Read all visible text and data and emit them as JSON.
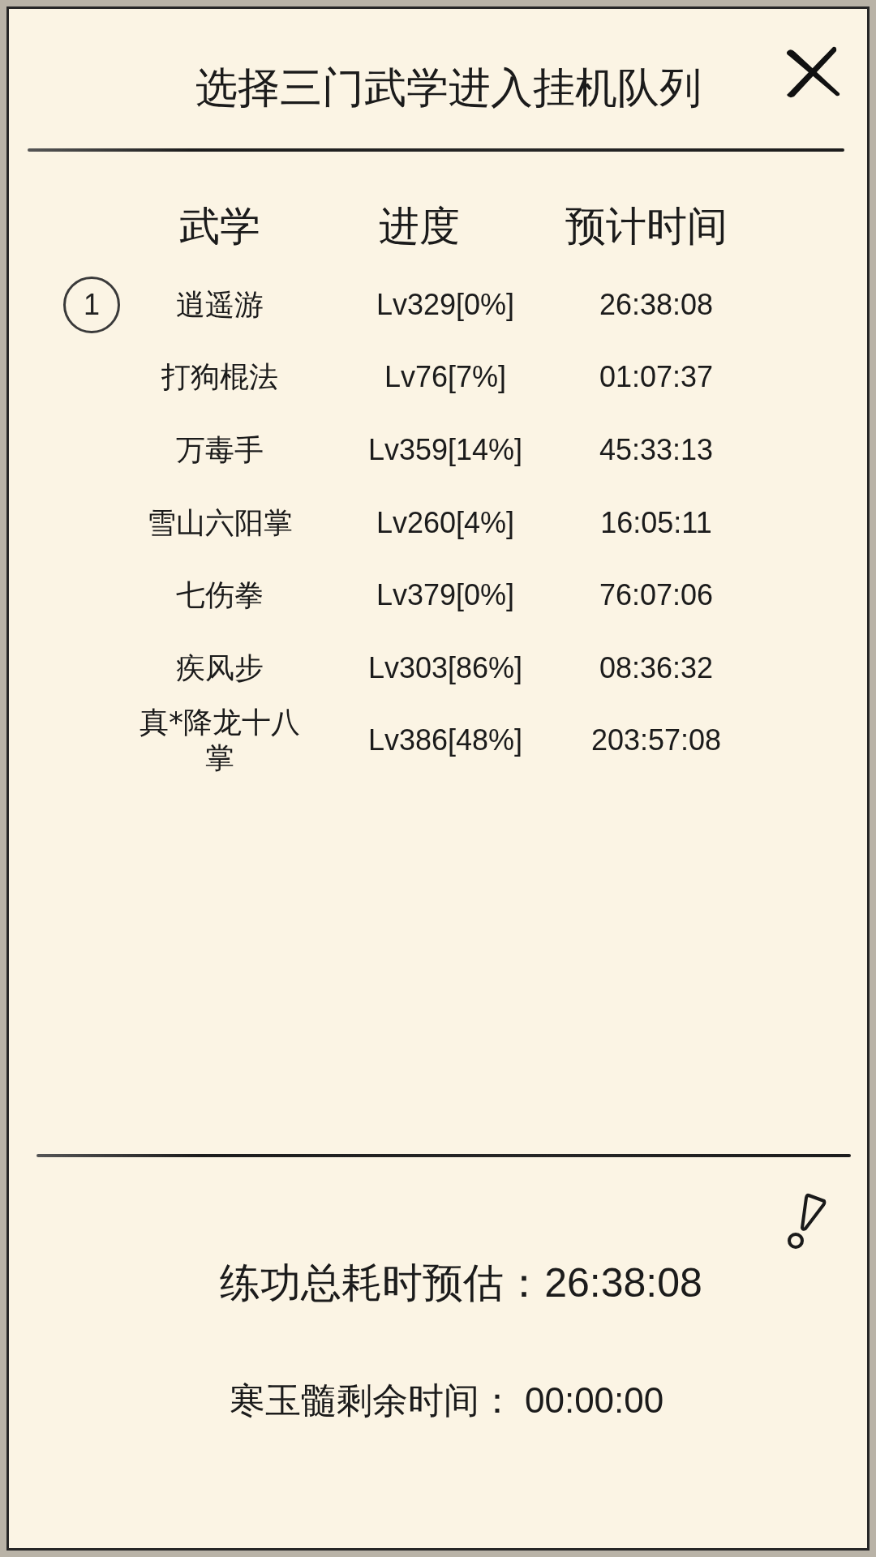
{
  "header": {
    "title": "选择三门武学进入挂机队列"
  },
  "table": {
    "columns": [
      "武学",
      "进度",
      "预计时间"
    ],
    "rows": [
      {
        "queue_number": "1",
        "name": "逍遥游",
        "progress": "Lv329[0%]",
        "time": "26:38:08"
      },
      {
        "name": "打狗棍法",
        "progress": "Lv76[7%]",
        "time": "01:07:37"
      },
      {
        "name": "万毒手",
        "progress": "Lv359[14%]",
        "time": "45:33:13"
      },
      {
        "name": "雪山六阳掌",
        "progress": "Lv260[4%]",
        "time": "16:05:11"
      },
      {
        "name": "七伤拳",
        "progress": "Lv379[0%]",
        "time": "76:07:06"
      },
      {
        "name": "疾风步",
        "progress": "Lv303[86%]",
        "time": "08:36:32"
      },
      {
        "name": "真*降龙十八掌",
        "progress": "Lv386[48%]",
        "time": "203:57:08"
      }
    ]
  },
  "summary": {
    "total_estimate": "练功总耗时预估：26:38:08",
    "remaining_time": "寒玉髓剩余时间： 00:00:00"
  }
}
